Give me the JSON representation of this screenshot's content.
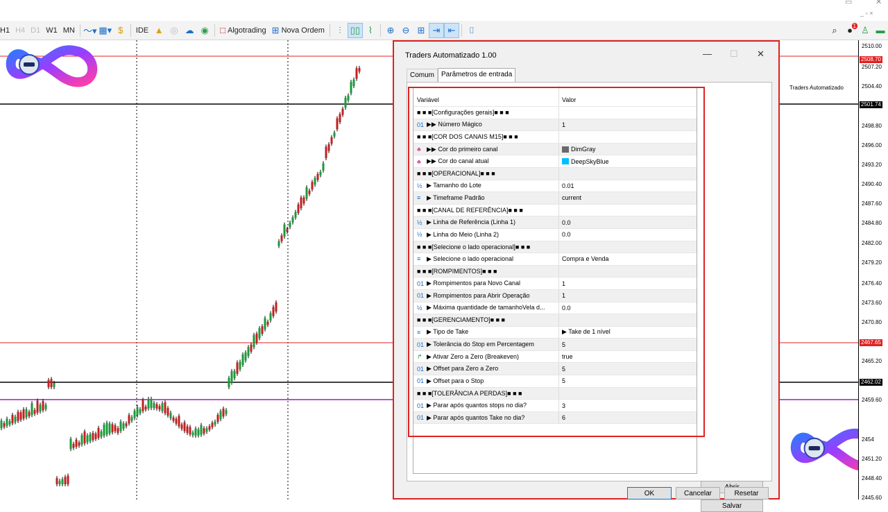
{
  "toolbar": {
    "timeframes": [
      "H1",
      "H4",
      "D1",
      "W1",
      "MN"
    ],
    "ide": "IDE",
    "algotrading": "Algotrading",
    "new_order": "Nova Ordem",
    "notification_count": "1"
  },
  "chart": {
    "ea_label": "Traders Automatizado",
    "price_ticks": [
      "2510.00",
      "2507.20",
      "2504.40",
      "2498.80",
      "2496.00",
      "2493.20",
      "2490.40",
      "2487.60",
      "2484.80",
      "2482.00",
      "2479.20",
      "2476.40",
      "2473.60",
      "2470.80",
      "2465.20",
      "2459.60",
      "2454",
      "2451.20",
      "2448.40",
      "2445.60"
    ],
    "price_tags": [
      {
        "label": "2508.70",
        "color": "#e02020"
      },
      {
        "label": "2501.74",
        "color": "#000000"
      },
      {
        "label": "2467.65",
        "color": "#e02020"
      },
      {
        "label": "2462.02",
        "color": "#000000"
      }
    ]
  },
  "dialog": {
    "title": "Traders Automatizado 1.00",
    "tabs": [
      "Comum",
      "Parâmetros de entrada"
    ],
    "columns": {
      "variable": "Variável",
      "value": "Valor"
    },
    "rows": [
      {
        "icon": "",
        "name": "■ ■ ■[Configurações gerais]■ ■ ■",
        "value": ""
      },
      {
        "icon": "01",
        "name": "▶▶ Número Mágico",
        "value": "1"
      },
      {
        "icon": "",
        "name": "■ ■ ■[COR DOS CANAIS M15]■ ■ ■",
        "value": ""
      },
      {
        "icon": "♣",
        "name": "▶▶ Cor do primeiro canal",
        "value": "DimGray",
        "swatch": "#696969"
      },
      {
        "icon": "♣",
        "name": "▶▶ Cor do canal atual",
        "value": "DeepSkyBlue",
        "swatch": "#00bfff"
      },
      {
        "icon": "",
        "name": "■ ■ ■[OPERACIONAL]■ ■ ■",
        "value": ""
      },
      {
        "icon": "½",
        "name": "▶ Tamanho do Lote",
        "value": "0.01"
      },
      {
        "icon": "≡",
        "name": "▶ Timeframe Padrão",
        "value": "current"
      },
      {
        "icon": "",
        "name": "■ ■ ■[CANAL DE REFERÊNCIA]■ ■ ■",
        "value": ""
      },
      {
        "icon": "½",
        "name": "▶ Linha de Referência (Linha 1)",
        "value": "0.0"
      },
      {
        "icon": "½",
        "name": "▶ Linha do Meio (Linha 2)",
        "value": "0.0"
      },
      {
        "icon": "",
        "name": "■ ■ ■[Selecione o lado operacional]■ ■ ■",
        "value": ""
      },
      {
        "icon": "≡",
        "name": "▶ Selecione o lado operacional",
        "value": "Compra e Venda"
      },
      {
        "icon": "",
        "name": "■ ■ ■[ROMPIMENTOS]■ ■ ■",
        "value": ""
      },
      {
        "icon": "01",
        "name": "▶ Rompimentos para Novo Canal",
        "value": "1"
      },
      {
        "icon": "01",
        "name": "▶ Rompimentos para Abrir Operação",
        "value": "1"
      },
      {
        "icon": "½",
        "name": "▶ Máxima quantidade de tamanhoVela d...",
        "value": "0.0"
      },
      {
        "icon": "",
        "name": "■ ■ ■[GERENCIAMENTO]■ ■ ■",
        "value": ""
      },
      {
        "icon": "≡",
        "name": "▶ Tipo de Take",
        "value": "▶ Take de 1 nível"
      },
      {
        "icon": "01",
        "name": "▶ Tolerância do Stop em Percentagem",
        "value": "5"
      },
      {
        "icon": "↱",
        "name": "▶ Ativar Zero a Zero (Breakeven)",
        "value": "true"
      },
      {
        "icon": "01",
        "name": "▶ Offset para Zero a Zero",
        "value": "5"
      },
      {
        "icon": "01",
        "name": "▶ Offset para o Stop",
        "value": "5"
      },
      {
        "icon": "",
        "name": "■ ■ ■[TOLERÂNCIA A PERDAS]■ ■ ■",
        "value": ""
      },
      {
        "icon": "01",
        "name": "▶ Parar após quantos stops no dia?",
        "value": "3"
      },
      {
        "icon": "01",
        "name": "▶ Parar após quantos Take no dia?",
        "value": "6"
      }
    ],
    "buttons": {
      "open": "Abrir",
      "save": "Salvar",
      "ok": "OK",
      "cancel": "Cancelar",
      "reset": "Resetar"
    }
  }
}
